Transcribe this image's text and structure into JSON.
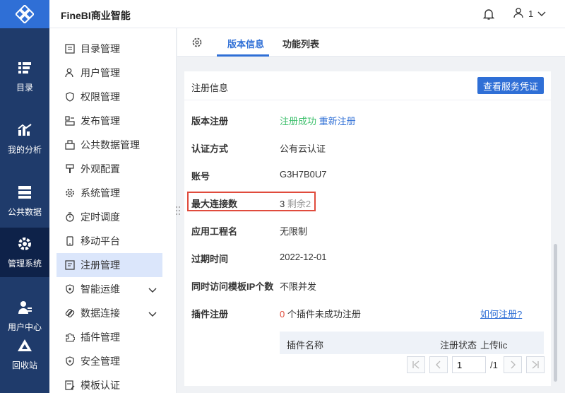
{
  "app": {
    "title": "FineBI商业智能"
  },
  "header": {
    "user_name": "1"
  },
  "rail": [
    {
      "label": "目录",
      "icon": "catalog-icon"
    },
    {
      "label": "我的分析",
      "icon": "analysis-icon"
    },
    {
      "label": "公共数据",
      "icon": "database-icon"
    },
    {
      "label": "管理系统",
      "icon": "gear-icon"
    },
    {
      "label": "用户中心",
      "icon": "user-center-icon"
    },
    {
      "label": "回收站",
      "icon": "recycle-icon"
    }
  ],
  "submenu": [
    {
      "label": "目录管理",
      "icon": "list-icon"
    },
    {
      "label": "用户管理",
      "icon": "user-icon"
    },
    {
      "label": "权限管理",
      "icon": "shield-icon"
    },
    {
      "label": "发布管理",
      "icon": "publish-icon"
    },
    {
      "label": "公共数据管理",
      "icon": "cube-icon"
    },
    {
      "label": "外观配置",
      "icon": "brush-icon"
    },
    {
      "label": "系统管理",
      "icon": "settings-icon"
    },
    {
      "label": "定时调度",
      "icon": "timer-icon"
    },
    {
      "label": "移动平台",
      "icon": "mobile-icon"
    },
    {
      "label": "注册管理",
      "icon": "register-icon"
    },
    {
      "label": "智能运维",
      "icon": "ops-icon"
    },
    {
      "label": "数据连接",
      "icon": "link-icon"
    },
    {
      "label": "插件管理",
      "icon": "puzzle-icon"
    },
    {
      "label": "安全管理",
      "icon": "security-icon"
    },
    {
      "label": "模板认证",
      "icon": "template-icon"
    }
  ],
  "tabs": {
    "version_info": "版本信息",
    "feature_list": "功能列表"
  },
  "panel": {
    "header_label": "注册信息",
    "view_cert_button": "查看服务凭证",
    "rows": {
      "version_reg_label": "版本注册",
      "version_reg_status": "注册成功",
      "version_reg_action": "重新注册",
      "auth_method_label": "认证方式",
      "auth_method_value": "公有云认证",
      "account_label": "账号",
      "account_value": "G3H7B0U7",
      "max_conn_label": "最大连接数",
      "max_conn_value": "3",
      "max_conn_remaining": "剩余2",
      "app_project_label": "应用工程名",
      "app_project_value": "无限制",
      "expire_label": "过期时间",
      "expire_value": "2022-12-01",
      "concurrent_label": "同时访问模板IP个数",
      "concurrent_value": "不限并发",
      "plugin_reg_label": "插件注册",
      "plugin_unreg_count": "0",
      "plugin_unreg_text": "个插件未成功注册",
      "how_to_register": "如何注册?"
    },
    "plugin_table": {
      "col_name": "插件名称",
      "col_status": "注册状态",
      "col_upload": "上传lic"
    },
    "pager": {
      "current_page": "1",
      "total": "/1"
    }
  },
  "colors": {
    "accent": "#2f6fd6",
    "rail_bg": "#1f3b6b",
    "success": "#3cbf6b",
    "danger": "#e04b3c"
  }
}
